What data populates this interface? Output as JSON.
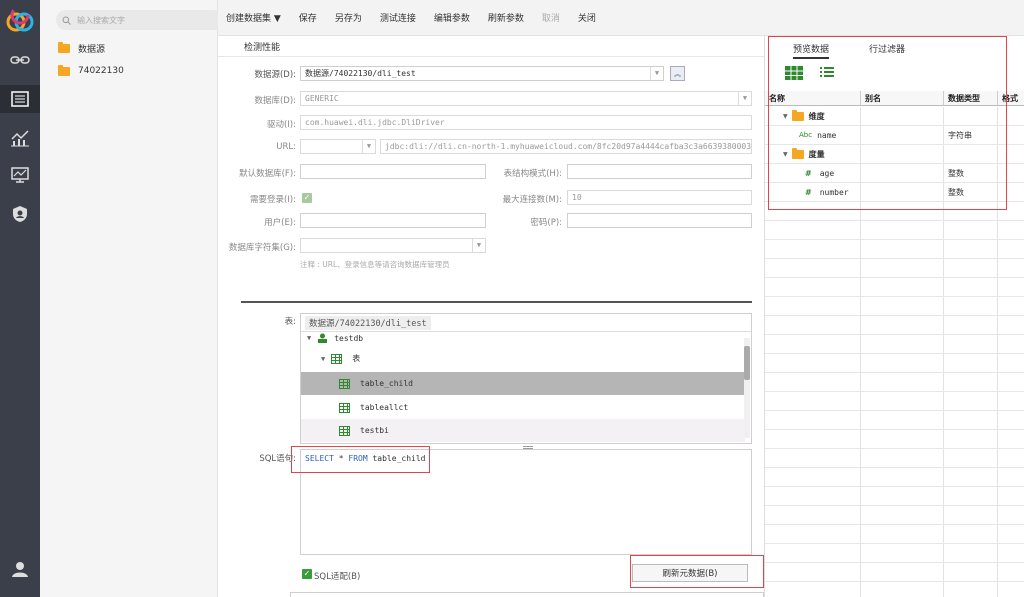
{
  "search": {
    "placeholder": "输入搜索文字"
  },
  "tree": {
    "items": [
      "数据源",
      "74022130"
    ]
  },
  "toolbar": {
    "create_dataset": "创建数据集 ▼",
    "save": "保存",
    "save_as": "另存为",
    "test_connection": "测试连接",
    "edit_params": "编辑参数",
    "refresh_params": "刷新参数",
    "cancel": "取消",
    "close": "关闭"
  },
  "form": {
    "section_title": "检测性能",
    "datasource_label": "数据源(D):",
    "datasource_value": "数据源/74022130/dli_test",
    "database_label": "数据库(D):",
    "database_value": "GENERIC",
    "driver_label": "驱动(I):",
    "driver_value": "com.huawei.dli.jdbc.DliDriver",
    "url_label": "URL:",
    "url_value": "jdbc:dli://dli.cn-north-1.myhuaweicloud.com/8fc20d97a4444cafba3c3a6639380003?qu",
    "default_db_label": "默认数据库(F):",
    "schema_label": "表结构模式(H):",
    "login_label": "需要登录(I):",
    "max_conn_label": "最大连接数(M):",
    "max_conn_value": "10",
    "user_label": "用户(E):",
    "password_label": "密码(P):",
    "charset_label": "数据库字符集(G):",
    "hint": "注释 : URL、登录信息等请咨询数据库管理员",
    "table_label": "表:",
    "table_path": "数据源/74022130/dli_test",
    "sql_label": "SQL语句:",
    "sql_kw1": "SELECT",
    "sql_star": "*",
    "sql_kw2": "FROM",
    "sql_table": "table_child",
    "sql_adapt_label": "SQL适配(B)",
    "refresh_metadata": "刷新元数据(B)"
  },
  "table_tree": {
    "db": "testdb",
    "group": "表",
    "tables": [
      "table_child",
      "tableallct",
      "testbi"
    ]
  },
  "preview": {
    "tabs": [
      "预览数据",
      "行过滤器"
    ],
    "columns": [
      "名称",
      "别名",
      "数据类型",
      "格式"
    ],
    "rows": [
      {
        "name": "维度",
        "alias": "",
        "type": "",
        "kind": "folder"
      },
      {
        "name": "name",
        "alias": "",
        "type": "字符串",
        "kind": "text",
        "prefix": "Abc"
      },
      {
        "name": "度量",
        "alias": "",
        "type": "",
        "kind": "folder"
      },
      {
        "name": "age",
        "alias": "",
        "type": "整数",
        "kind": "number",
        "prefix": "#"
      },
      {
        "name": "number",
        "alias": "",
        "type": "整数",
        "kind": "number",
        "prefix": "#"
      }
    ]
  },
  "colors": {
    "accent_green": "#2d8a2d",
    "highlight_red": "#e0454a",
    "sidebar_bg": "#3b3f49",
    "keyword_blue": "#2b5fc7"
  }
}
